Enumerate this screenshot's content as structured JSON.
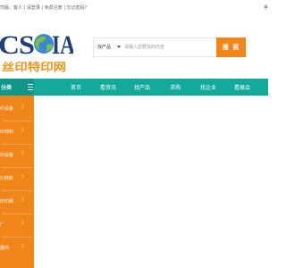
{
  "topbar": {
    "greeting_prefix": "司版。客人 |",
    "login": "请登录",
    "register": "免费注册",
    "forgot": "忘记密码?",
    "right_char": "手"
  },
  "logo": {
    "wordmark": "CSGIA",
    "slogan": "丝印特印网",
    "colors": {
      "navy": "#1f3f7a",
      "globe_blue": "#3a87d6",
      "globe_green": "#7bc043",
      "slogan": "#e8951e"
    }
  },
  "search": {
    "category": "找产品",
    "placeholder": "请输入您要找的内容",
    "button": "搜 索"
  },
  "nav": {
    "category_label": "分类",
    "items": [
      "首页",
      "看资讯",
      "找产品",
      "求购",
      "找企业",
      "看展会"
    ]
  },
  "sidebar": {
    "items": [
      "印设备",
      "印材料",
      "印设备",
      "印材料",
      "印印刷",
      "厂",
      "展商"
    ]
  },
  "colors": {
    "teal": "#14aa9b",
    "teal_dark": "#0f9789",
    "orange": "#f08519"
  }
}
